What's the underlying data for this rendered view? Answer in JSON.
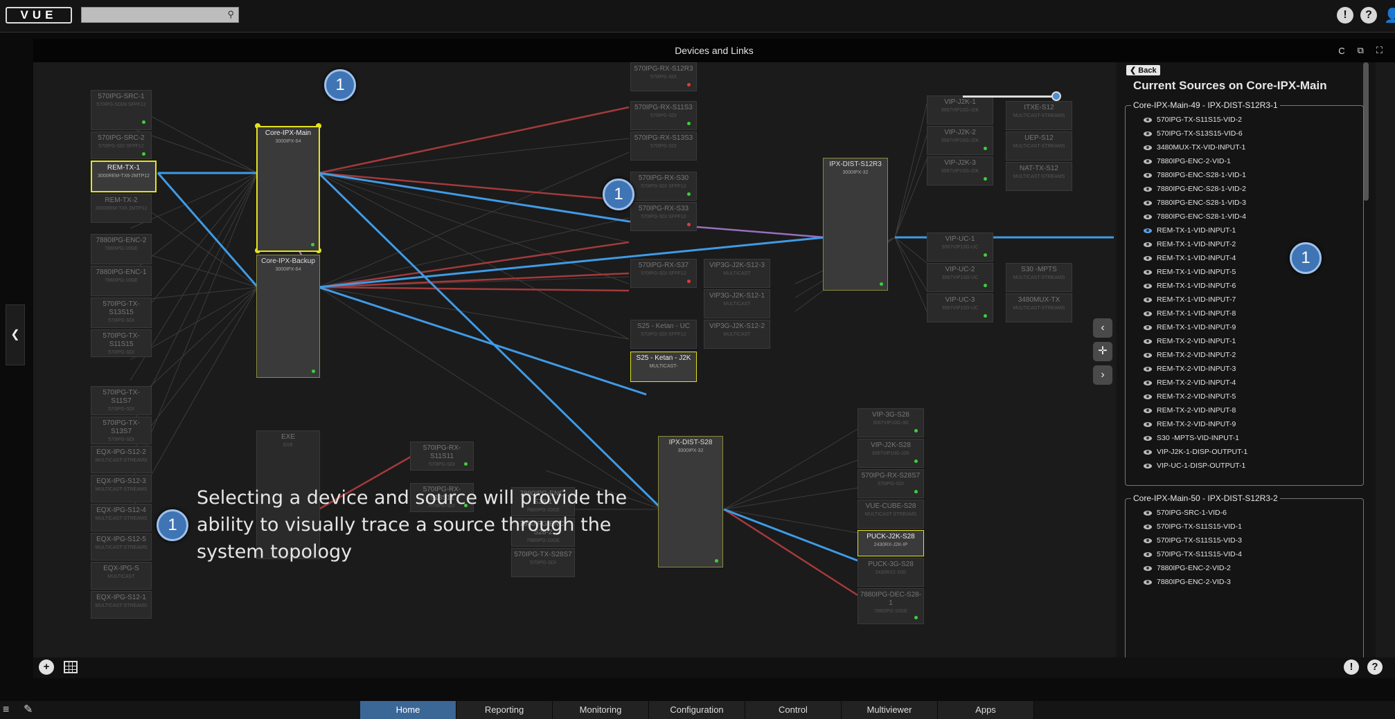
{
  "header": {
    "logo": "VUE",
    "search_placeholder": "",
    "search_icon": "search-icon",
    "icons": [
      "alert-icon",
      "help-icon",
      "user-icon"
    ],
    "alert": "!",
    "help": "?"
  },
  "panel": {
    "title": "Devices and Links",
    "tools": [
      "refresh-icon",
      "popout-icon",
      "expand-icon"
    ],
    "tool_glyphs": [
      "C",
      "⧉",
      "⛶"
    ]
  },
  "nodes": [
    {
      "id": "570IPG-SRC-1",
      "sub": "570IPG-SDI/8 SFPF12",
      "state": "dim"
    },
    {
      "id": "570IPG-SRC-2",
      "sub": "570IPG-SDI SFPF12",
      "state": "dim"
    },
    {
      "id": "REM-TX-1",
      "sub": "3000REM-TX6-2MTP12",
      "state": "sel"
    },
    {
      "id": "REM-TX-2",
      "sub": "3000REM-TX6 2MTP12",
      "state": "dim"
    },
    {
      "id": "7880IPG-ENC-2",
      "sub": "7880IPG-10GE",
      "state": "dim"
    },
    {
      "id": "7880IPG-ENC-1",
      "sub": "7880IPG-10GE",
      "state": "dim"
    },
    {
      "id": "570IPG-TX-S13S15",
      "sub": "570IPG-SDI",
      "state": "dim"
    },
    {
      "id": "570IPG-TX-S11S15",
      "sub": "570IPG-SDI",
      "state": "dim"
    },
    {
      "id": "570IPG-TX-S11S7",
      "sub": "570IPG-SDI",
      "state": "dim"
    },
    {
      "id": "570IPG-TX-S13S7",
      "sub": "570IPG-SDI",
      "state": "dim"
    },
    {
      "id": "EQX-IPG-S12-2",
      "sub": "MULTICAST-STREAMS",
      "state": "dim"
    },
    {
      "id": "EQX-IPG-S12-3",
      "sub": "MULTICAST-STREAMS",
      "state": "dim"
    },
    {
      "id": "EQX-IPG-S12-4",
      "sub": "MULTICAST-STREAMS",
      "state": "dim"
    },
    {
      "id": "EQX-IPG-S12-5",
      "sub": "MULTICAST-STREAMS",
      "state": "dim"
    },
    {
      "id": "EQX-IPG-S",
      "sub": "MULTICAST",
      "state": "dim"
    },
    {
      "id": "EQX-IPG-S12-1",
      "sub": "MULTICAST-STREAMS",
      "state": "dim"
    },
    {
      "id": "Core-IPX-Main",
      "sub": "3000IPX-64",
      "state": "sel"
    },
    {
      "id": "Core-IPX-Backup",
      "sub": "3000IPX-64",
      "state": "big"
    },
    {
      "id": "EXE",
      "sub": "EXE",
      "state": "dim"
    },
    {
      "id": "570IPG-RX-S12R3",
      "sub": "570IPG-SDI",
      "state": "dim"
    },
    {
      "id": "570IPG-RX-S11S3",
      "sub": "570IPG-SDI",
      "state": "dim"
    },
    {
      "id": "570IPG-RX-S13S3",
      "sub": "570IPG-SDI",
      "state": "dim"
    },
    {
      "id": "570IPG-RX-S30",
      "sub": "570IPG-SDI SFPF12",
      "state": "dim"
    },
    {
      "id": "570IPG-RX-S33",
      "sub": "570IPG-SDI SFPF12",
      "state": "dim"
    },
    {
      "id": "570IPG-RX-S37",
      "sub": "570IPG-SDI SFPF12",
      "state": "dim"
    },
    {
      "id": "VIP3G-J2K-S12-3",
      "sub": "MULTICAST",
      "state": "dim"
    },
    {
      "id": "VIP3G-J2K-S12-1",
      "sub": "MULTICAST",
      "state": "dim"
    },
    {
      "id": "VIP3G-J2K-S12-2",
      "sub": "MULTICAST",
      "state": "dim"
    },
    {
      "id": "S25 - Ketan - UC",
      "sub": "570IPG-SDI SFPF12",
      "state": "dim"
    },
    {
      "id": "S25 - Ketan - J2K",
      "sub": "MULTICAST-",
      "state": "sel"
    },
    {
      "id": "570IPG-RX-S11S11",
      "sub": "570IPG-SDI",
      "state": "dim"
    },
    {
      "id": "570IPG-RX-S13S11",
      "sub": "570IPG-SDI",
      "state": "dim"
    },
    {
      "id": "7880IPG-ENC-S28-1",
      "sub": "7880IPG-10GE",
      "state": "dim"
    },
    {
      "id": "7880IPG-ENC-S28-2",
      "sub": "7880IPG-10GE",
      "state": "dim"
    },
    {
      "id": "570IPG-TX-S28S7",
      "sub": "570IPG-SDI",
      "state": "dim"
    },
    {
      "id": "IPX-DIST-S12R3",
      "sub": "3000IPX-32",
      "state": "big"
    },
    {
      "id": "IPX-DIST-S28",
      "sub": "3000IPX-32",
      "state": "big"
    },
    {
      "id": "VIP-J2K-1",
      "sub": "3067VIP10G-J2K",
      "state": "dim"
    },
    {
      "id": "VIP-J2K-2",
      "sub": "3067VIP10G-J2K",
      "state": "dim"
    },
    {
      "id": "VIP-J2K-3",
      "sub": "3067VIP10G-J2K",
      "state": "dim"
    },
    {
      "id": "VIP-UC-1",
      "sub": "3067VIP10G-UC",
      "state": "dim"
    },
    {
      "id": "VIP-UC-2",
      "sub": "3067VIP10G-UC",
      "state": "dim"
    },
    {
      "id": "VIP-UC-3",
      "sub": "3067VIP10G-UC",
      "state": "dim"
    },
    {
      "id": "ITXE-S12",
      "sub": "MULTICAST-STREAMS",
      "state": "dim"
    },
    {
      "id": "UEP-S12",
      "sub": "MULTICAST-STREAMS",
      "state": "dim"
    },
    {
      "id": "NAT-TX-S12",
      "sub": "MULTICAST-STREAMS",
      "state": "dim"
    },
    {
      "id": "S30 -MPTS",
      "sub": "MULTICAST-STREAMS",
      "state": "dim"
    },
    {
      "id": "3480MUX-TX",
      "sub": "MULTICAST-STREAMS",
      "state": "dim"
    },
    {
      "id": "VIP-3G-S28",
      "sub": "3067VIP10G-3G",
      "state": "dim"
    },
    {
      "id": "VIP-J2K-S28",
      "sub": "3067VIP10G-J2K",
      "state": "dim"
    },
    {
      "id": "570IPG-RX-S28S7",
      "sub": "570IPG-SDI",
      "state": "dim"
    },
    {
      "id": "VUE-CUBE-S28",
      "sub": "MULTICAST-STREAMS",
      "state": "dim"
    },
    {
      "id": "PUCK-J2K-S28",
      "sub": "2430RX-J2K-IP",
      "state": "sel"
    },
    {
      "id": "PUCK-3G-S28",
      "sub": "2430RX2-10G",
      "state": "dim"
    },
    {
      "id": "7880IPG-DEC-S28-1",
      "sub": "7880IPG-10GE",
      "state": "dim"
    }
  ],
  "markers": [
    "1",
    "1",
    "1",
    "1"
  ],
  "caption": "Selecting a device and source will provide the ability to visually trace a source through the system topology",
  "sidebar": {
    "back": "Back",
    "title": "Current Sources on Core-IPX-Main",
    "groups": [
      {
        "name": "Core-IPX-Main-49 - IPX-DIST-S12R3-1",
        "items": [
          "570IPG-TX-S11S15-VID-2",
          "570IPG-TX-S13S15-VID-6",
          "3480MUX-TX-VID-INPUT-1",
          "7880IPG-ENC-2-VID-1",
          "7880IPG-ENC-S28-1-VID-1",
          "7880IPG-ENC-S28-1-VID-2",
          "7880IPG-ENC-S28-1-VID-3",
          "7880IPG-ENC-S28-1-VID-4",
          "REM-TX-1-VID-INPUT-1",
          "REM-TX-1-VID-INPUT-2",
          "REM-TX-1-VID-INPUT-4",
          "REM-TX-1-VID-INPUT-5",
          "REM-TX-1-VID-INPUT-6",
          "REM-TX-1-VID-INPUT-7",
          "REM-TX-1-VID-INPUT-8",
          "REM-TX-1-VID-INPUT-9",
          "REM-TX-2-VID-INPUT-1",
          "REM-TX-2-VID-INPUT-2",
          "REM-TX-2-VID-INPUT-3",
          "REM-TX-2-VID-INPUT-4",
          "REM-TX-2-VID-INPUT-5",
          "REM-TX-2-VID-INPUT-8",
          "REM-TX-2-VID-INPUT-9",
          "S30 -MPTS-VID-INPUT-1",
          "VIP-J2K-1-DISP-OUTPUT-1",
          "VIP-UC-1-DISP-OUTPUT-1"
        ],
        "selected": "REM-TX-1-VID-INPUT-1"
      },
      {
        "name": "Core-IPX-Main-50 - IPX-DIST-S12R3-2",
        "items": [
          "570IPG-SRC-1-VID-6",
          "570IPG-TX-S11S15-VID-1",
          "570IPG-TX-S11S15-VID-3",
          "570IPG-TX-S11S15-VID-4",
          "7880IPG-ENC-2-VID-2",
          "7880IPG-ENC-2-VID-3"
        ],
        "selected": ""
      }
    ]
  },
  "footer": {
    "add": "+",
    "alert": "!",
    "help": "?"
  },
  "bottom_nav": {
    "tabs": [
      "Home",
      "Reporting",
      "Monitoring",
      "Configuration",
      "Control",
      "Multiviewer",
      "Apps"
    ],
    "active": "Home"
  },
  "colors": {
    "trace": "#3f9be6",
    "link_red": "#a33a3a",
    "link_purple": "#9a6fbf",
    "selected_border": "#e4e31d",
    "marker": "#3f74b5",
    "active_tab": "#3b6797"
  }
}
